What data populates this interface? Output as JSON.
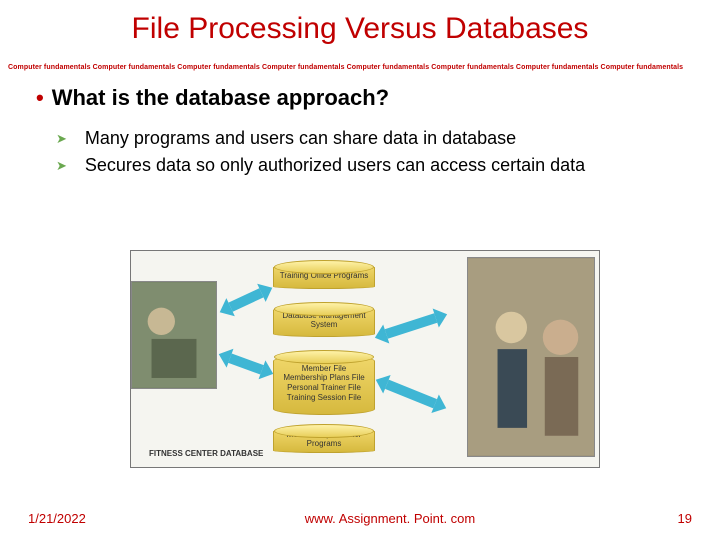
{
  "title": "File Processing Versus Databases",
  "watermark_line": "Computer fundamentals Computer fundamentals Computer fundamentals Computer fundamentals Computer fundamentals Computer fundamentals Computer fundamentals Computer fundamentals",
  "heading": "What is the database approach?",
  "points": {
    "p1": "Many programs and users can share data in database",
    "p2": "Secures data so only authorized users can access certain data"
  },
  "diagram": {
    "node_training_office": "Training Office Programs",
    "node_dbms": "Database Management System",
    "node_files": "Member File\nMembership Plans File\nPersonal Trainer File\nTraining Session File",
    "node_counter": "Membership Counter Programs",
    "caption": "FITNESS CENTER DATABASE"
  },
  "footer": {
    "date": "1/21/2022",
    "site": "www. Assignment. Point. com",
    "page": "19"
  }
}
